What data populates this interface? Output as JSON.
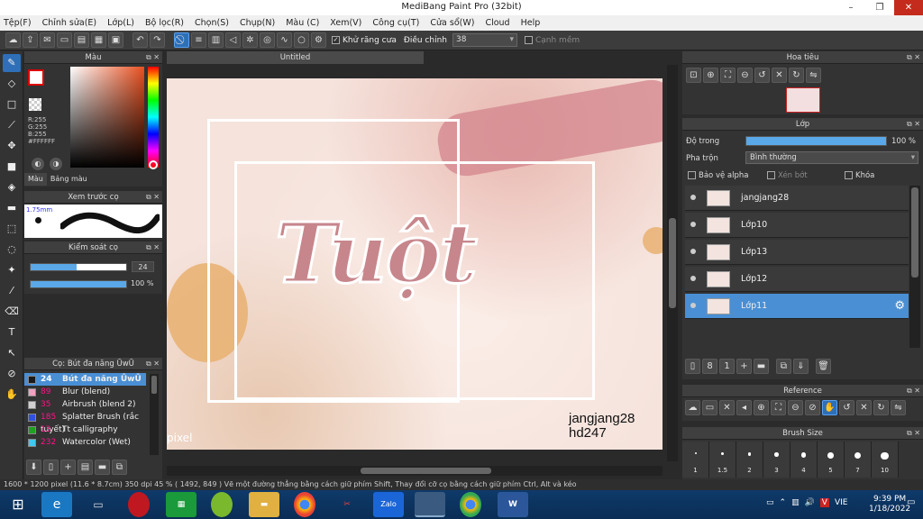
{
  "window": {
    "title": "MediBang Paint Pro (32bit)"
  },
  "menu": [
    "Tệp(F)",
    "Chỉnh sửa(E)",
    "Lớp(L)",
    "Bộ lọc(R)",
    "Chọn(S)",
    "Chụp(N)",
    "Màu (C)",
    "Xem(V)",
    "Công cụ(T)",
    "Cửa sổ(W)",
    "Cloud",
    "Help"
  ],
  "toolbar": {
    "antialias_label": "Khử răng cưa",
    "adjust_label": "Điều chỉnh",
    "adjust_value": "38",
    "snap_label": "Cạnh mềm"
  },
  "color_panel": {
    "title": "Màu",
    "r": "R:255",
    "g": "G:255",
    "b": "B:255",
    "hex": "#FFFFFF",
    "tab_color": "Màu",
    "tab_palette": "Bảng màu"
  },
  "brush_preview": {
    "title": "Xem trước cọ",
    "size": "1.75mm"
  },
  "brush_control": {
    "title": "Kiểm soát cọ",
    "size_value": "24",
    "opacity_value": "100 %",
    "size_fraction": 0.48,
    "opacity_fraction": 1.0
  },
  "brush_list": {
    "title": "Cọ: Bút đa năng ŪwŪ",
    "items": [
      {
        "num": "24",
        "name": "Bút đa năng ŪwŪ",
        "color": "#1a1a1a",
        "selected": true
      },
      {
        "num": "89",
        "name": "Blur (blend)",
        "color": "#f0a0c0"
      },
      {
        "num": "35",
        "name": "Airbrush (blend 2)",
        "color": "#d0d0d0"
      },
      {
        "num": "185",
        "name": "Splatter Brush (rắc tuyết)",
        "color": "#3050e0"
      },
      {
        "num": "13",
        "name": "Tt calligraphy",
        "color": "#20a020"
      },
      {
        "num": "232",
        "name": "Watercolor (Wet)",
        "color": "#40c8f0"
      }
    ]
  },
  "canvas": {
    "tab": "Untitled",
    "artwork_text": "Tuột",
    "watermark_line1": "jangjang28",
    "watermark_line2": "hd247",
    "corner_text": "pixel"
  },
  "navigator": {
    "title": "Hoa tiêu"
  },
  "layer_panel": {
    "title": "Lớp",
    "opacity_label": "Độ trong",
    "opacity_value": "100 %",
    "opacity_fraction": 1.0,
    "blend_label": "Pha trộn",
    "blend_value": "Bình thường",
    "protect_alpha": "Bảo vệ alpha",
    "clipping": "Xén bớt",
    "lock": "Khóa",
    "layers": [
      {
        "name": "jangjang28",
        "selected": false
      },
      {
        "name": "Lớp10",
        "selected": false
      },
      {
        "name": "Lớp13",
        "selected": false
      },
      {
        "name": "Lớp12",
        "selected": false
      },
      {
        "name": "Lớp11",
        "selected": true
      }
    ]
  },
  "reference": {
    "title": "Reference"
  },
  "brush_size": {
    "title": "Brush Size",
    "sizes": [
      "1",
      "1.5",
      "2",
      "3",
      "4",
      "5",
      "7",
      "10"
    ]
  },
  "status": {
    "text": "1600 * 1200 pixel  (11.6 * 8.7cm)  350 dpi  45 %  ( 1492, 849 )  Vẽ một đường thẳng bằng cách giữ phím Shift, Thay đổi cỡ cọ bằng cách giữ phím Ctrl, Alt và kéo"
  },
  "taskbar": {
    "time": "9:39 PM",
    "date": "1/18/2022",
    "lang": "VIE",
    "zalo": "Zalo"
  }
}
